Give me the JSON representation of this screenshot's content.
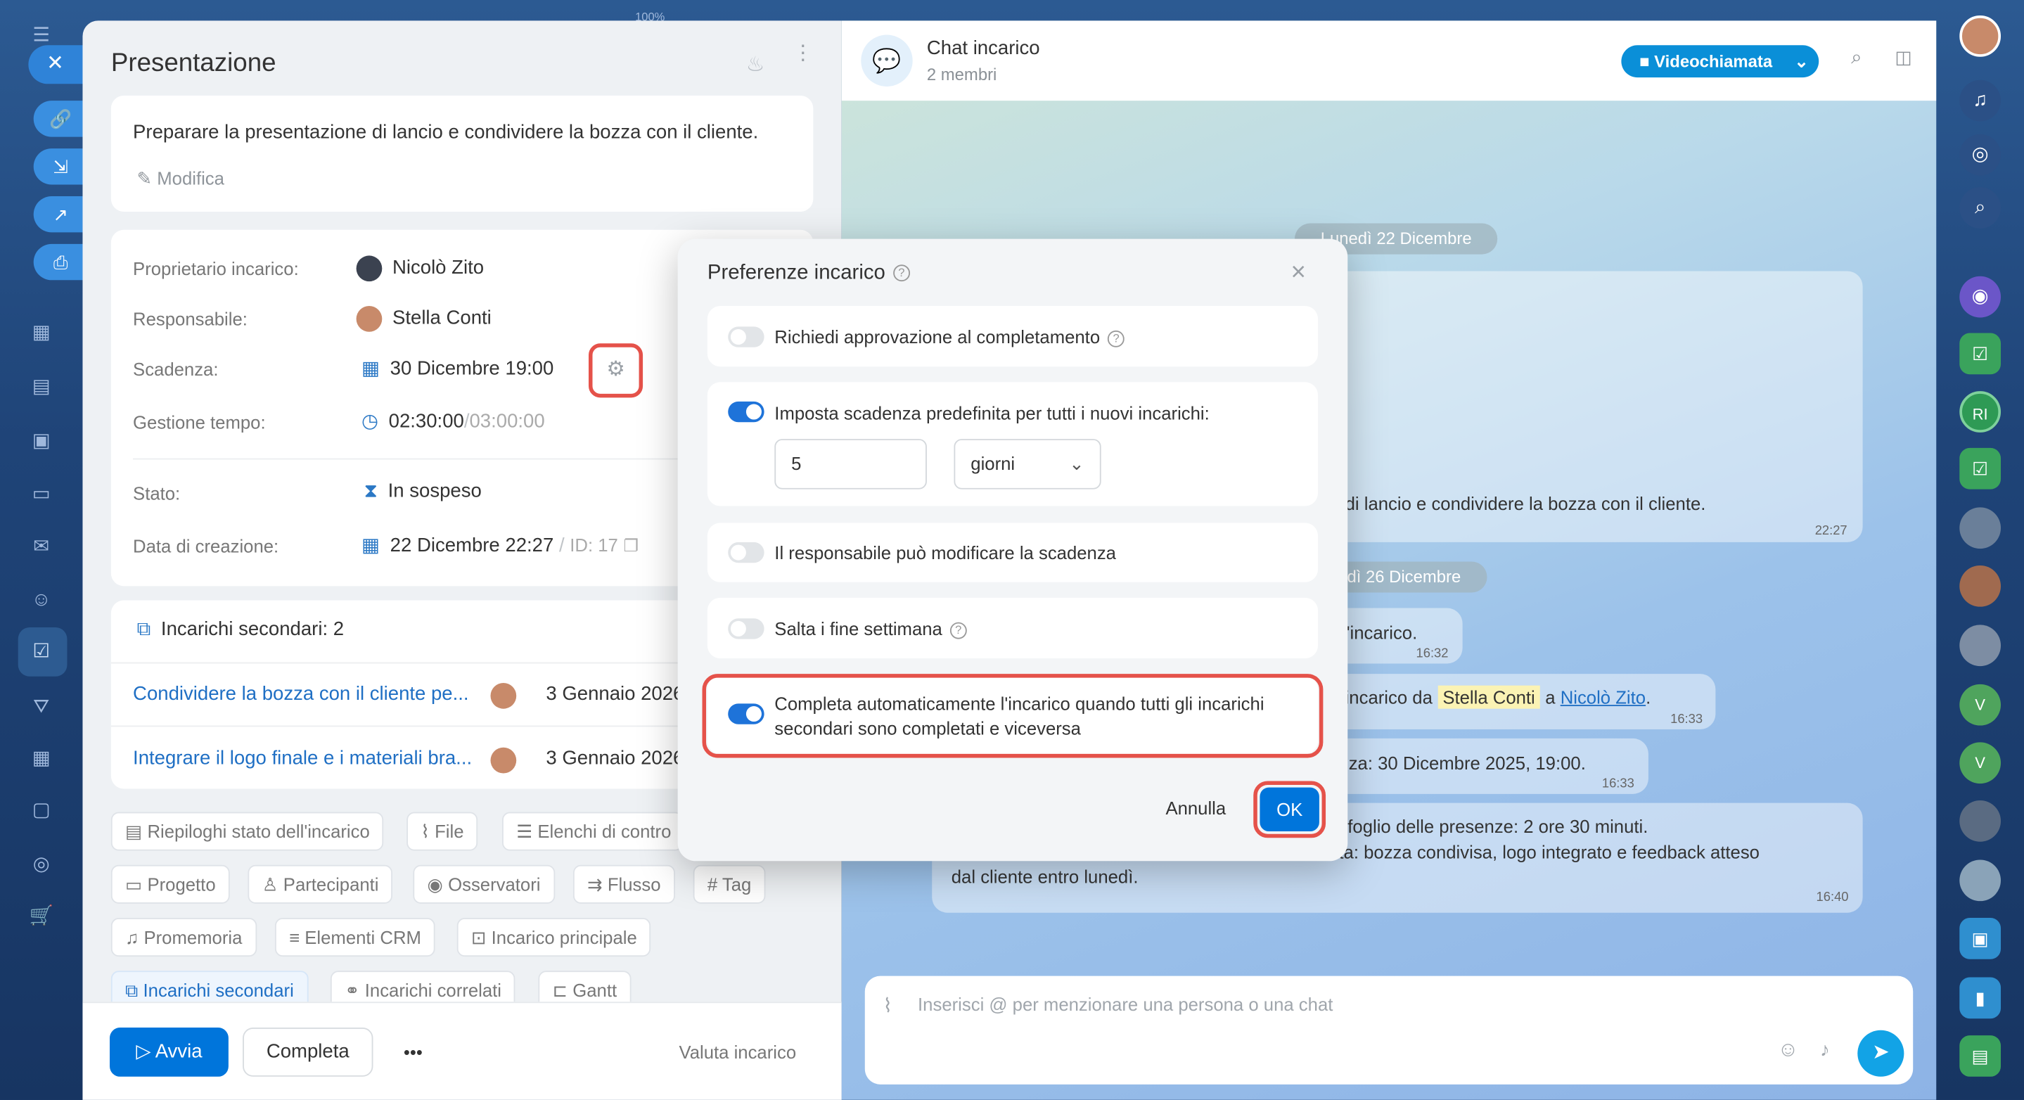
{
  "task": {
    "title": "Presentazione",
    "description": "Preparare la presentazione di lancio e condividere la bozza con il cliente.",
    "edit_label": "Modifica",
    "fields": {
      "owner_label": "Proprietario incarico:",
      "owner_value": "Nicolò Zito",
      "assignee_label": "Responsabile:",
      "assignee_value": "Stella Conti",
      "deadline_label": "Scadenza:",
      "deadline_value": "30 Dicembre 19:00",
      "time_label": "Gestione tempo:",
      "time_spent": "02:30:00",
      "time_sep": "/",
      "time_total": "03:00:00",
      "status_label": "Stato:",
      "status_value": "In sospeso",
      "created_label": "Data di creazione:",
      "created_value": "22 Dicembre 22:27",
      "id_sep": "/",
      "id_value": "ID: 17"
    },
    "subtasks": {
      "header": "Incarichi secondari: 2",
      "items": [
        {
          "title": "Condividere la bozza con il cliente pe...",
          "date": "3 Gennaio 2026"
        },
        {
          "title": "Integrare il logo finale e i materiali bra...",
          "date": "3 Gennaio 2026"
        }
      ]
    },
    "chips": [
      "Riepiloghi stato dell'incarico",
      "File",
      "Elenchi di contro",
      "Progetto",
      "Partecipanti",
      "Osservatori",
      "Flusso",
      "Tag",
      "Promemoria",
      "Elementi CRM",
      "Incarico principale",
      "Incarichi secondari",
      "Incarichi correlati",
      "Gantt"
    ],
    "actions": {
      "start": "Avvia",
      "complete": "Completa",
      "more": "•••",
      "rate": "Valuta incarico"
    }
  },
  "chat": {
    "title": "Chat incarico",
    "subtitle": "2 membri",
    "video_button": "Videochiamata",
    "date1": "Lunedì 22 Dicembre",
    "msg1_text": "di lancio e condividere la bozza con il cliente.",
    "msg1_time": "22:27",
    "date2": "erdì 26 Dicembre",
    "msg2_text": "l'incarico.",
    "msg2_time": "16:32",
    "msg3_pre": "incarico da",
    "msg3_name1": "Stella Conti",
    "msg3_mid": "a",
    "msg3_name2": "Nicolò Zito",
    "msg3_end": ".",
    "msg3_time": "16:33",
    "msg4_text": "nza: 30 Dicembre 2025, 19:00.",
    "msg4_time": "16:33",
    "msg5_line1": "l foglio delle presenze: 2 ore 30 minuti.",
    "msg5_line2": "ta: bozza condivisa, logo integrato e feedback atteso",
    "msg5_line3": "dal cliente entro lunedì.",
    "msg5_time": "16:40",
    "input_placeholder": "Inserisci @ per menzionare una persona o una chat"
  },
  "modal": {
    "title": "Preferenze incarico",
    "opt1": {
      "label": "Richiedi approvazione al completamento",
      "enabled": false
    },
    "opt2": {
      "label": "Imposta scadenza predefinita per tutti i nuovi incarichi:",
      "enabled": true,
      "amount": "5",
      "unit": "giorni"
    },
    "opt3": {
      "label": "Il responsabile può modificare la scadenza",
      "enabled": false
    },
    "opt4": {
      "label": "Salta i fine settimana",
      "enabled": false
    },
    "opt5": {
      "label_line1": "Completa automaticamente l'incarico quando tutti gli incarichi",
      "label_line2": "secondari sono completati e viceversa",
      "enabled": true
    },
    "cancel": "Annulla",
    "ok": "OK"
  },
  "rail": {
    "zoom": "100%",
    "avatar_initials_1": "RI",
    "avatar_initials_2": "V",
    "avatar_initials_3": "V"
  },
  "colors": {
    "accent": "#0075db",
    "highlight": "#e5524a",
    "video": "#0a8fd8"
  }
}
